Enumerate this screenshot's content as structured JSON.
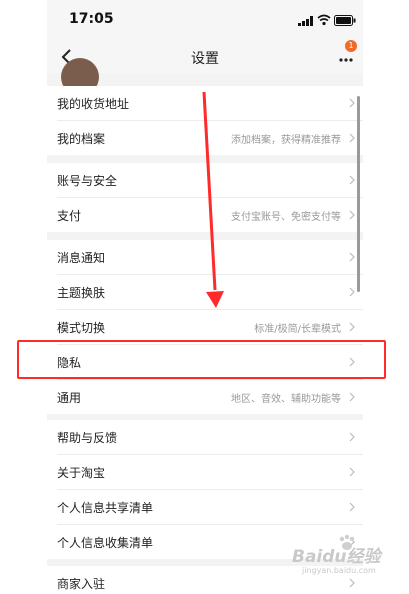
{
  "status_bar": {
    "time": "17:05"
  },
  "nav": {
    "title": "设置",
    "badge_count": "1"
  },
  "groups": [
    {
      "items": [
        {
          "label": "我的收货地址",
          "hint": ""
        },
        {
          "label": "我的档案",
          "hint": "添加档案，获得精准推荐"
        }
      ]
    },
    {
      "items": [
        {
          "label": "账号与安全",
          "hint": ""
        },
        {
          "label": "支付",
          "hint": "支付宝账号、免密支付等"
        }
      ]
    },
    {
      "items": [
        {
          "label": "消息通知",
          "hint": ""
        },
        {
          "label": "主题换肤",
          "hint": ""
        },
        {
          "label": "模式切换",
          "hint": "标准/极简/长辈模式"
        },
        {
          "label": "隐私",
          "hint": ""
        },
        {
          "label": "通用",
          "hint": "地区、音效、辅助功能等"
        }
      ]
    },
    {
      "items": [
        {
          "label": "帮助与反馈",
          "hint": ""
        },
        {
          "label": "关于淘宝",
          "hint": ""
        },
        {
          "label": "个人信息共享清单",
          "hint": ""
        },
        {
          "label": "个人信息收集清单",
          "hint": ""
        }
      ]
    },
    {
      "items": [
        {
          "label": "商家入驻",
          "hint": ""
        }
      ]
    }
  ],
  "watermark": {
    "logo": "Baidu经验",
    "sub": "jingyan.baidu.com"
  },
  "colors": {
    "annotation": "#ff2a2a",
    "badge": "#f06a2a"
  }
}
